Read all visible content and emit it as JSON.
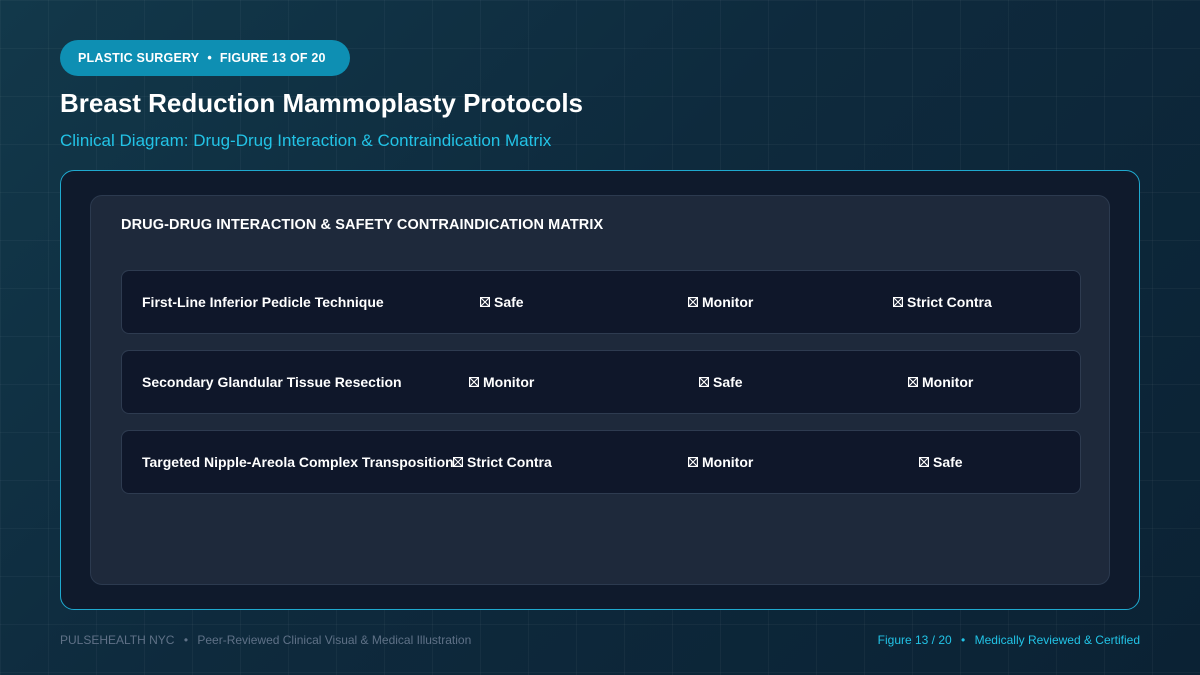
{
  "header": {
    "category": "PLASTIC SURGERY",
    "separator": "•",
    "figure_label": "FIGURE 13 OF 20",
    "title": "Breast Reduction Mammoplasty Protocols",
    "subtitle": "Clinical Diagram: Drug-Drug Interaction & Contraindication Matrix"
  },
  "matrix": {
    "title": "DRUG-DRUG INTERACTION & SAFETY CONTRAINDICATION MATRIX",
    "status_icon": "x-box-icon",
    "rows": [
      {
        "label": "First-Line Inferior Pedicle Technique",
        "cells": [
          "Safe",
          "Monitor",
          "Strict Contra"
        ]
      },
      {
        "label": "Secondary Glandular Tissue Resection",
        "cells": [
          "Monitor",
          "Safe",
          "Monitor"
        ]
      },
      {
        "label": "Targeted Nipple-Areola Complex Transposition",
        "cells": [
          "Strict Contra",
          "Monitor",
          "Safe"
        ]
      }
    ]
  },
  "footer": {
    "brand": "PULSEHEALTH NYC",
    "separator": "•",
    "tagline": "Peer-Reviewed Clinical Visual & Medical Illustration",
    "figure_counter": "Figure 13 / 20",
    "certification": "Medically Reviewed & Certified"
  },
  "colors": {
    "accent": "#22c3e6",
    "pill": "#0e8fb3",
    "frame_border": "#1fa9cf",
    "panel": "#1e293b",
    "row": "#0f172a"
  }
}
